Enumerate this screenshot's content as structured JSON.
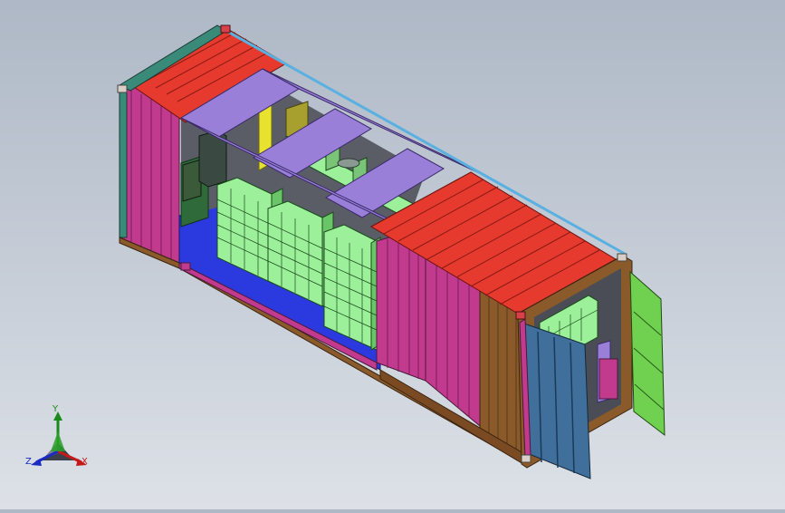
{
  "viewport": {
    "background_top": "#aeb8c6",
    "background_bottom": "#dde1e7"
  },
  "model": {
    "colors": {
      "roof_panel": "#e63a2e",
      "purple_beam": "#9a7fd8",
      "magenta_wall": "#c23a8e",
      "brown_wall": "#8a5a2a",
      "battery_module": "#9cf09a",
      "floor": "#2a3adf",
      "door_blue": "#3f6f9a",
      "door_green": "#6fd14f",
      "teal_post": "#3a8a7a",
      "cabinet_green": "#2f6b3a",
      "yellow_wall": "#e8e22e"
    }
  },
  "triad": {
    "x_label": "X",
    "y_label": "Y",
    "z_label": "Z",
    "x_color": "#c41a1a",
    "y_color": "#1a8a1a",
    "z_color": "#1a2ac4"
  }
}
